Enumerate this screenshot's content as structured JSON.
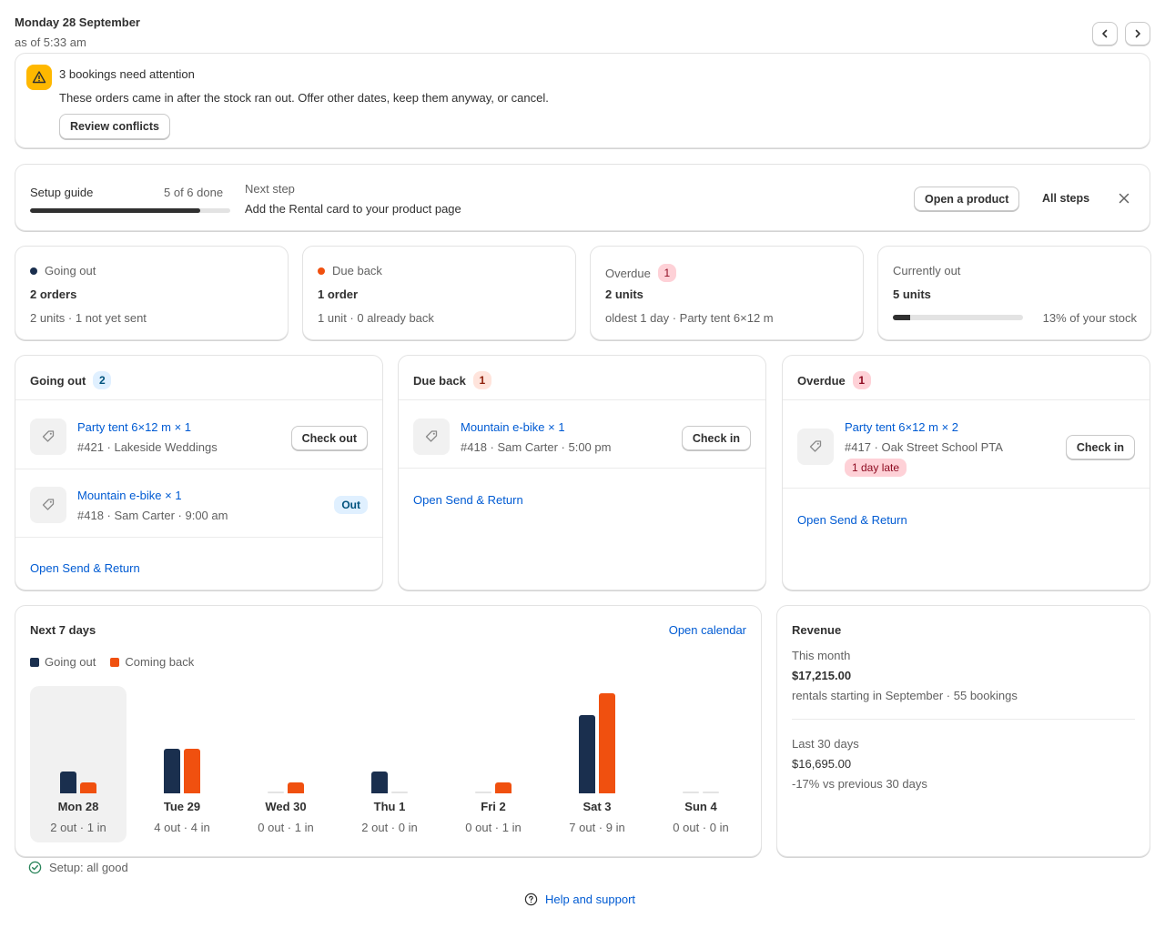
{
  "header": {
    "date": "Monday 28 September",
    "as_of": "as of 5:33 am"
  },
  "alert": {
    "title": "3 bookings need attention",
    "message": "These orders came in after the stock ran out. Offer other dates, keep them anyway, or cancel.",
    "button": "Review conflicts"
  },
  "setup_guide": {
    "label": "Setup guide",
    "progress_text": "5 of 6 done",
    "progress_fraction": 0.85,
    "next_label": "Next step",
    "next_text": "Add the Rental card to your product page",
    "open_button": "Open a product",
    "all_steps": "All steps"
  },
  "stats": {
    "going_out": {
      "label": "Going out",
      "value": "2 orders",
      "sub": "2 units · 1 not yet sent",
      "color": "#1a2f4e"
    },
    "due_back": {
      "label": "Due back",
      "value": "1 order",
      "sub": "1 unit · 0 already back",
      "color": "#f0500f"
    },
    "overdue": {
      "label": "Overdue",
      "badge": "1",
      "value": "2 units",
      "sub": "oldest 1 day · Party tent 6×12 m"
    },
    "currently_out": {
      "label": "Currently out",
      "value": "5 units",
      "percent_text": "13% of your stock",
      "fraction": 0.13
    }
  },
  "going_out_list": {
    "title": "Going out",
    "badge": "2",
    "items": [
      {
        "name": "Party tent 6×12 m × 1",
        "meta": "#421 · Lakeside Weddings",
        "action": "Check out"
      },
      {
        "name": "Mountain e-bike × 1",
        "meta": "#418 · Sam Carter · 9:00 am",
        "status": "Out"
      }
    ],
    "link": "Open Send & Return"
  },
  "due_back_list": {
    "title": "Due back",
    "badge": "1",
    "items": [
      {
        "name": "Mountain e-bike × 1",
        "meta": "#418 · Sam Carter · 5:00 pm",
        "action": "Check in"
      }
    ],
    "link": "Open Send & Return"
  },
  "overdue_list": {
    "title": "Overdue",
    "badge": "1",
    "items": [
      {
        "name": "Party tent 6×12 m × 2",
        "meta": "#417 · Oak Street School PTA",
        "late": "1 day late",
        "action": "Check in"
      }
    ],
    "link": "Open Send & Return"
  },
  "next7": {
    "title": "Next 7 days",
    "calendar_link": "Open calendar",
    "legend": {
      "out": "Going out",
      "back": "Coming back"
    },
    "colors": {
      "out": "#1a2f4e",
      "back": "#f0500f"
    }
  },
  "chart_data": {
    "type": "bar",
    "categories": [
      "Mon 28",
      "Tue 29",
      "Wed 30",
      "Thu 1",
      "Fri 2",
      "Sat 3",
      "Sun 4"
    ],
    "series": [
      {
        "name": "Going out",
        "values": [
          2,
          4,
          0,
          2,
          0,
          7,
          0
        ]
      },
      {
        "name": "Coming back",
        "values": [
          1,
          4,
          1,
          0,
          1,
          9,
          0
        ]
      }
    ],
    "day_labels": [
      "2 out · 1 in",
      "4 out · 4 in",
      "0 out · 1 in",
      "2 out · 0 in",
      "0 out · 1 in",
      "7 out · 9 in",
      "0 out · 0 in"
    ],
    "highlighted": "Mon 28"
  },
  "revenue": {
    "title": "Revenue",
    "this_month_label": "This month",
    "this_month_amount": "$17,215.00",
    "this_month_detail": "rentals starting in September · 55 bookings",
    "last30_label": "Last 30 days",
    "last30_amount": "$16,695.00",
    "last30_detail": "-17% vs previous 30 days"
  },
  "footer": {
    "status": "Setup: all good",
    "help": "Help and support"
  }
}
